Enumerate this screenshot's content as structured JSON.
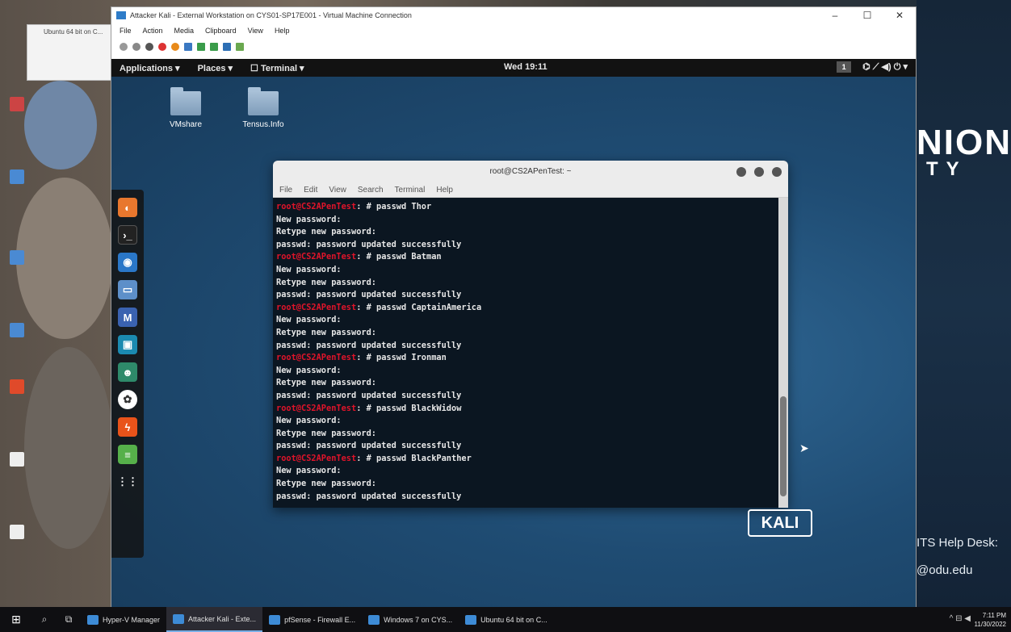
{
  "vm_window": {
    "title": "Attacker Kali - External Workstation on CYS01-SP17E001 - Virtual Machine Connection",
    "menu": [
      "File",
      "Action",
      "Media",
      "Clipboard",
      "View",
      "Help"
    ],
    "controls": [
      "–",
      "☐",
      "✕"
    ]
  },
  "back_window": {
    "title": "Ubuntu 64 bit on C..."
  },
  "kali": {
    "topbar": {
      "applications": "Applications ▾",
      "places": "Places ▾",
      "terminal": "☐ Terminal ▾",
      "clock": "Wed 19:11",
      "workspace": "1",
      "tray": "⌬  ⟋ ◀) ⏻ ▾"
    },
    "desktop_icons": [
      {
        "label": "VMshare"
      },
      {
        "label": "Tensus.Info"
      }
    ],
    "logo": "KALI"
  },
  "terminal": {
    "title": "root@CS2APenTest: ~",
    "menu": [
      "File",
      "Edit",
      "View",
      "Search",
      "Terminal",
      "Help"
    ],
    "prompt": "root@CS2APenTest",
    "lines": [
      {
        "prompt": "root@CS2APenTest",
        "cmd": ": # passwd Thor"
      },
      {
        "prompt": "",
        "cmd": "New password:"
      },
      {
        "prompt": "",
        "cmd": "Retype new password:"
      },
      {
        "prompt": "",
        "cmd": "passwd: password updated successfully"
      },
      {
        "prompt": "root@CS2APenTest",
        "cmd": ": # passwd Batman"
      },
      {
        "prompt": "",
        "cmd": "New password:"
      },
      {
        "prompt": "",
        "cmd": "Retype new password:"
      },
      {
        "prompt": "",
        "cmd": "passwd: password updated successfully"
      },
      {
        "prompt": "root@CS2APenTest",
        "cmd": ": # passwd CaptainAmerica"
      },
      {
        "prompt": "",
        "cmd": "New password:"
      },
      {
        "prompt": "",
        "cmd": "Retype new password:"
      },
      {
        "prompt": "",
        "cmd": "passwd: password updated successfully"
      },
      {
        "prompt": "root@CS2APenTest",
        "cmd": ": # passwd Ironman"
      },
      {
        "prompt": "",
        "cmd": "New password:"
      },
      {
        "prompt": "",
        "cmd": "Retype new password:"
      },
      {
        "prompt": "",
        "cmd": "passwd: password updated successfully"
      },
      {
        "prompt": "root@CS2APenTest",
        "cmd": ": # passwd BlackWidow"
      },
      {
        "prompt": "",
        "cmd": "New password:"
      },
      {
        "prompt": "",
        "cmd": "Retype new password:"
      },
      {
        "prompt": "",
        "cmd": "passwd: password updated successfully"
      },
      {
        "prompt": "root@CS2APenTest",
        "cmd": ": # passwd BlackPanther"
      },
      {
        "prompt": "",
        "cmd": "New password:"
      },
      {
        "prompt": "",
        "cmd": "Retype new password:"
      },
      {
        "prompt": "",
        "cmd": "passwd: password updated successfully"
      }
    ]
  },
  "host": {
    "brand_line1": "NION",
    "brand_line2": "TY",
    "help_line1": "ITS Help Desk:",
    "help_line2": "@odu.edu"
  },
  "taskbar": {
    "start": "⊞",
    "search": "⌕",
    "taskview": "⧉",
    "tasks": [
      {
        "label": "Hyper-V Manager",
        "active": false
      },
      {
        "label": "Attacker Kali - Exte...",
        "active": true
      },
      {
        "label": "pfSense - Firewall E...",
        "active": false
      },
      {
        "label": "Windows 7 on CYS...",
        "active": false
      },
      {
        "label": "Ubuntu 64 bit on C...",
        "active": false
      }
    ],
    "systray": "^ ⊟ ◀",
    "clock_time": "7:11 PM",
    "clock_date": "11/30/2022"
  },
  "colors": {
    "prompt": "#e0142a",
    "kali_bg": "#1f4c73",
    "taskbar": "#0f0f12"
  }
}
